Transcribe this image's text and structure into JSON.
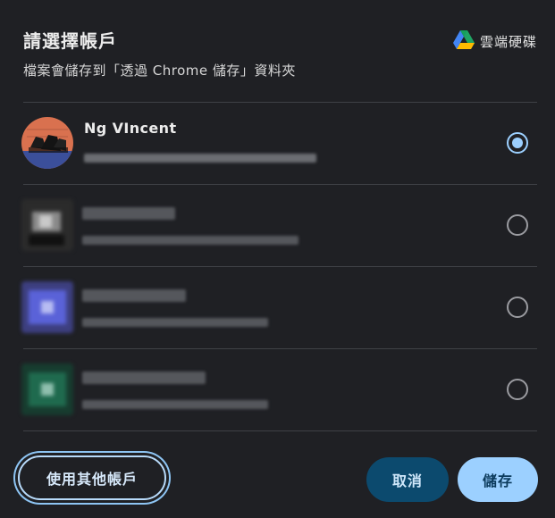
{
  "dialog": {
    "title": "請選擇帳戶",
    "subtitle": "檔案會儲存到「透過 Chrome 儲存」資料夾",
    "brand_name": "雲端硬碟",
    "brand_icon": "google-drive-icon"
  },
  "accounts": [
    {
      "name": "Ng VIncent",
      "selected": true
    },
    {
      "name": "",
      "selected": false
    },
    {
      "name": "",
      "selected": false
    },
    {
      "name": "",
      "selected": false
    }
  ],
  "footer": {
    "other_account_label": "使用其他帳戶",
    "cancel_label": "取消",
    "save_label": "儲存"
  },
  "colors": {
    "background": "#1f2024",
    "accent": "#9cd0ff",
    "cancel_bg": "#0c4a6e"
  }
}
